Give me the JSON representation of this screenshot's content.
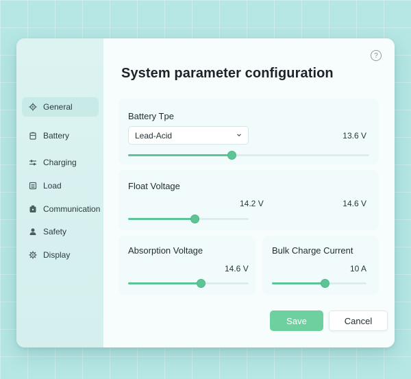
{
  "window": {
    "title": "System parameter configuration",
    "help_icon": "question-circle-icon"
  },
  "sidebar": {
    "items": [
      {
        "label": "General",
        "icon": "gear-icon",
        "active": true
      },
      {
        "label": "Battery",
        "icon": "battery-icon"
      },
      {
        "label": "Charging",
        "icon": "sliders-icon"
      },
      {
        "label": "Load",
        "icon": "list-icon"
      },
      {
        "label": "Communication",
        "icon": "chip-icon"
      },
      {
        "label": "Safety",
        "icon": "user-shield-icon"
      },
      {
        "label": "Display",
        "icon": "gear-icon"
      }
    ]
  },
  "settings": {
    "battery_type": {
      "label": "Battery Tpe",
      "selected": "Lead-Acid",
      "value": "13.6 V",
      "slider_level": 0.43
    },
    "float_voltage": {
      "label": "Float Voltage",
      "value_a": "14.2 V",
      "value_b": "14.6 V",
      "slider_level": 0.55
    },
    "absorption_voltage": {
      "label": "Absorption Voltage",
      "value": "14.6 V",
      "slider_level": 0.6
    },
    "bulk_charge_current": {
      "label": "Bulk Charge Current",
      "value": "10 A",
      "slider_level": 0.56
    }
  },
  "buttons": {
    "save": "Save",
    "cancel": "Cancel"
  },
  "colors": {
    "accent": "#5cc495",
    "save_bg": "#6ed09e",
    "background": "#b6e7e5"
  }
}
